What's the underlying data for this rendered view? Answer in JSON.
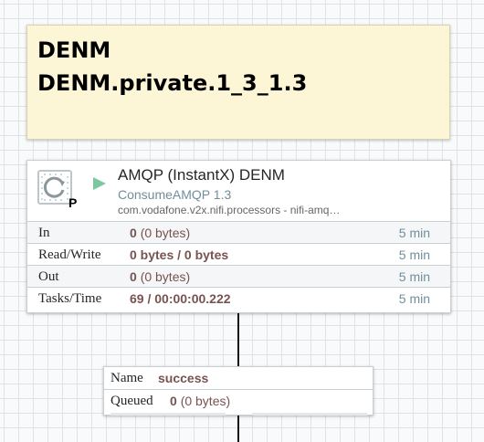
{
  "label": {
    "line1": "DENM",
    "line2": "DENM.private.1_3_1.3",
    "background_color": "#fcf5d6"
  },
  "processor": {
    "name": "AMQP (InstantX) DENM",
    "type": "ConsumeAMQP 1.3",
    "bundle": "com.vodafone.v2x.nifi.processors - nifi-amq…",
    "icon": "processor-icon",
    "badge": "P",
    "status_icon": "running-icon",
    "stats": [
      {
        "label": "In",
        "value": "0",
        "detail": "(0 bytes)",
        "time": "5 min"
      },
      {
        "label": "Read/Write",
        "value": "0 bytes / 0 bytes",
        "detail": "",
        "time": "5 min"
      },
      {
        "label": "Out",
        "value": "0",
        "detail": "(0 bytes)",
        "time": "5 min"
      },
      {
        "label": "Tasks/Time",
        "value": "69 / 00:00:00.222",
        "detail": "",
        "time": "5 min"
      }
    ]
  },
  "connection": {
    "name_label": "Name",
    "name_value": "success",
    "queued_label": "Queued",
    "queued_value": "0",
    "queued_detail": "(0 bytes)"
  },
  "colors": {
    "canvas": "#f9fafb",
    "grid": "#dfe3e6",
    "value_text": "#775351",
    "muted_text": "#728e9b",
    "running": "#7dc7a0"
  }
}
